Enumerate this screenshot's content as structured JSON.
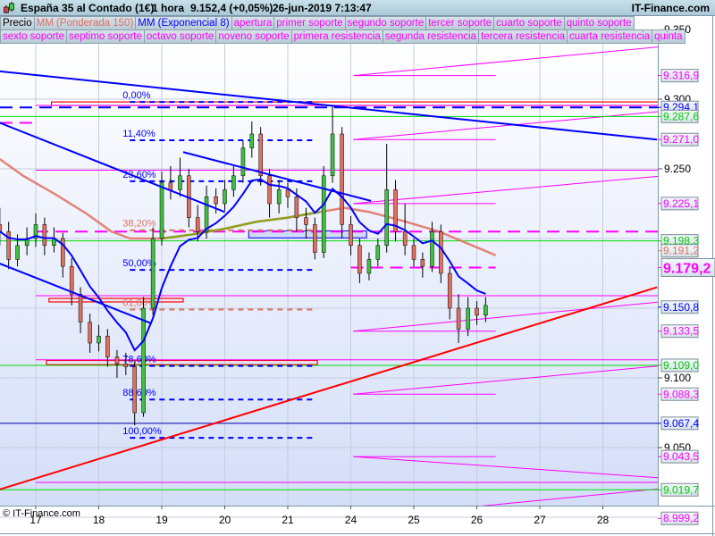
{
  "header": {
    "title": "España 35 al Contado (1€)",
    "interval": "1 hora",
    "price": "9.152,4 (+0,05%)",
    "datetime": "26-jun-2019 7:13:47",
    "brand": "IT-Finance.com",
    "icon": "candlestick-icon"
  },
  "legend": {
    "row1": [
      {
        "label": "Precio",
        "color": "#000000"
      },
      {
        "label": "MM (Ponderada 150)",
        "color": "#e07060"
      },
      {
        "label": "MM (Exponencial 8)",
        "color": "#0000ff"
      },
      {
        "label": "apertura",
        "color": "#ff00ff"
      },
      {
        "label": "primer soporte",
        "color": "#ff00ff"
      },
      {
        "label": "segundo soporte",
        "color": "#ff00ff"
      },
      {
        "label": "tercer soporte",
        "color": "#ff00ff"
      },
      {
        "label": "cuarto soporte",
        "color": "#ff00ff"
      },
      {
        "label": "quinto soporte",
        "color": "#ff00ff"
      }
    ],
    "row2": [
      {
        "label": "sexto soporte",
        "color": "#ff00ff"
      },
      {
        "label": "septimo soporte",
        "color": "#ff00ff"
      },
      {
        "label": "octavo soporte",
        "color": "#ff00ff"
      },
      {
        "label": "noveno soporte",
        "color": "#ff00ff"
      },
      {
        "label": "primera resistencia",
        "color": "#ff00ff"
      },
      {
        "label": "segunda resistencia",
        "color": "#ff00ff"
      },
      {
        "label": "tercera resistencia",
        "color": "#ff00ff"
      },
      {
        "label": "cuarta resistencia",
        "color": "#ff00ff"
      },
      {
        "label": "quinta",
        "color": "#ff00ff"
      }
    ]
  },
  "copyright": "© IT-Finance.com",
  "chart_data": {
    "type": "candlestick",
    "title": "España 35 al Contado (1€)",
    "x_ticks": [
      "17",
      "18",
      "19",
      "20",
      "21",
      "24",
      "25",
      "26",
      "27",
      "28"
    ],
    "y_ticks": [
      "9.350",
      "9.300",
      "9.250",
      "9.100",
      "9.050"
    ],
    "ylim": [
      8.991,
      9.36
    ],
    "grid": true,
    "colors": {
      "up": "#40c040",
      "down": "#e07060",
      "wick": "#000000",
      "ema": "#0000ff",
      "wma": "#e07060",
      "wma_alt": "#90a020",
      "pivot": "#ff00ff",
      "support_green": "#00dd00",
      "trend_red": "#ff0000"
    },
    "candles": [
      [
        16.43,
        9.21,
        9.222,
        9.195,
        9.205
      ],
      [
        16.57,
        9.205,
        9.212,
        9.178,
        9.185
      ],
      [
        16.71,
        9.185,
        9.203,
        9.18,
        9.195
      ],
      [
        16.86,
        9.195,
        9.208,
        9.188,
        9.2
      ],
      [
        17.0,
        9.2,
        9.218,
        9.194,
        9.21
      ],
      [
        17.14,
        9.21,
        9.215,
        9.188,
        9.195
      ],
      [
        17.29,
        9.195,
        9.208,
        9.19,
        9.2
      ],
      [
        17.43,
        9.2,
        9.204,
        9.172,
        9.18
      ],
      [
        17.57,
        9.18,
        9.186,
        9.152,
        9.16
      ],
      [
        17.71,
        9.16,
        9.165,
        9.132,
        9.14
      ],
      [
        17.86,
        9.14,
        9.146,
        9.118,
        9.125
      ],
      [
        18.0,
        9.125,
        9.138,
        9.119,
        9.13
      ],
      [
        18.14,
        9.13,
        9.135,
        9.108,
        9.115
      ],
      [
        18.29,
        9.115,
        9.12,
        9.1,
        9.11
      ],
      [
        18.43,
        9.11,
        9.118,
        9.102,
        9.108
      ],
      [
        18.57,
        9.108,
        9.112,
        9.066,
        9.075
      ],
      [
        18.71,
        9.075,
        9.158,
        9.072,
        9.15
      ],
      [
        18.86,
        9.15,
        9.208,
        9.145,
        9.2
      ],
      [
        19.0,
        9.2,
        9.248,
        9.195,
        9.24
      ],
      [
        19.14,
        9.24,
        9.252,
        9.228,
        9.235
      ],
      [
        19.29,
        9.235,
        9.258,
        9.23,
        9.245
      ],
      [
        19.43,
        9.245,
        9.25,
        9.208,
        9.215
      ],
      [
        19.57,
        9.215,
        9.224,
        9.198,
        9.205
      ],
      [
        19.71,
        9.205,
        9.238,
        9.2,
        9.23
      ],
      [
        19.86,
        9.23,
        9.236,
        9.218,
        9.225
      ],
      [
        20.0,
        9.225,
        9.242,
        9.22,
        9.235
      ],
      [
        20.14,
        9.235,
        9.252,
        9.23,
        9.245
      ],
      [
        20.29,
        9.245,
        9.27,
        9.24,
        9.265
      ],
      [
        20.43,
        9.265,
        9.284,
        9.258,
        9.275
      ],
      [
        20.57,
        9.275,
        9.28,
        9.238,
        9.245
      ],
      [
        20.71,
        9.245,
        9.25,
        9.215,
        9.225
      ],
      [
        20.86,
        9.225,
        9.242,
        9.218,
        9.235
      ],
      [
        21.0,
        9.235,
        9.24,
        9.222,
        9.23
      ],
      [
        21.14,
        9.23,
        9.236,
        9.205,
        9.215
      ],
      [
        21.29,
        9.215,
        9.222,
        9.2,
        9.21
      ],
      [
        21.43,
        9.21,
        9.215,
        9.185,
        9.19
      ],
      [
        21.57,
        9.19,
        9.252,
        9.186,
        9.245
      ],
      [
        21.71,
        9.245,
        9.295,
        9.24,
        9.275
      ],
      [
        21.86,
        9.275,
        9.28,
        9.2,
        9.21
      ],
      [
        24.0,
        9.21,
        9.216,
        9.188,
        9.195
      ],
      [
        24.14,
        9.195,
        9.2,
        9.168,
        9.175
      ],
      [
        24.29,
        9.175,
        9.19,
        9.17,
        9.185
      ],
      [
        24.43,
        9.185,
        9.2,
        9.18,
        9.195
      ],
      [
        24.57,
        9.195,
        9.268,
        9.19,
        9.235
      ],
      [
        24.71,
        9.235,
        9.242,
        9.198,
        9.205
      ],
      [
        24.86,
        9.205,
        9.225,
        9.188,
        9.195
      ],
      [
        25.0,
        9.195,
        9.2,
        9.18,
        9.185
      ],
      [
        25.14,
        9.185,
        9.19,
        9.172,
        9.18
      ],
      [
        25.29,
        9.18,
        9.212,
        9.176,
        9.205
      ],
      [
        25.43,
        9.205,
        9.21,
        9.168,
        9.175
      ],
      [
        25.57,
        9.175,
        9.18,
        9.142,
        9.15
      ],
      [
        25.71,
        9.15,
        9.16,
        9.125,
        9.135
      ],
      [
        25.86,
        9.135,
        9.158,
        9.13,
        9.15
      ],
      [
        26.0,
        9.15,
        9.155,
        9.138,
        9.145
      ],
      [
        26.14,
        9.145,
        9.158,
        9.14,
        9.152
      ]
    ],
    "ema_period": 8,
    "wma_150": [
      [
        16.43,
        9.257
      ],
      [
        16.8,
        9.245
      ],
      [
        17.3,
        9.232
      ],
      [
        17.8,
        9.218
      ],
      [
        18.2,
        9.205
      ],
      [
        18.5,
        9.2
      ],
      [
        19.0,
        9.2
      ],
      [
        19.5,
        9.203
      ],
      [
        20.0,
        9.207
      ],
      [
        20.5,
        9.212
      ],
      [
        21.0,
        9.215
      ],
      [
        21.5,
        9.219
      ],
      [
        21.9,
        9.222
      ],
      [
        24.3,
        9.219
      ],
      [
        24.8,
        9.213
      ],
      [
        25.4,
        9.205
      ],
      [
        26.3,
        9.188
      ]
    ],
    "wma_150_alt_segment": [
      18.6,
      21.8
    ],
    "trend_lines": [
      {
        "color": "#0000ff",
        "from": [
          16.43,
          9.32
        ],
        "to": [
          28.86,
          9.271
        ]
      },
      {
        "color": "#0000ff",
        "from": [
          16.43,
          9.283
        ],
        "to": [
          20.0,
          9.219
        ]
      },
      {
        "color": "#0000ff",
        "from": [
          19.34,
          9.262
        ],
        "to": [
          24.32,
          9.227
        ]
      },
      {
        "color": "#0000ff",
        "from": [
          16.43,
          9.182
        ],
        "to": [
          18.84,
          9.139
        ]
      },
      {
        "color": "#ff0000",
        "from": [
          16.43,
          9.02
        ],
        "to": [
          28.86,
          9.165
        ]
      }
    ],
    "horizontal_lines": [
      {
        "price": 9.2941,
        "color": "#0000ff",
        "style": "long-dash"
      },
      {
        "price": 9.2876,
        "color": "#00dd00",
        "style": "solid"
      },
      {
        "price": 9.1983,
        "color": "#00dd00",
        "style": "solid"
      },
      {
        "price": 9.109,
        "color": "#00dd00",
        "style": "solid"
      },
      {
        "price": 9.0197,
        "color": "#00dd00",
        "style": "solid"
      },
      {
        "price": 9.0674,
        "color": "#0000aa",
        "style": "solid"
      }
    ],
    "apertura": [
      {
        "price": 9.283,
        "from": 16.43,
        "to": 17.0
      },
      {
        "price": 9.205,
        "from": 17.0,
        "to": 23.96
      },
      {
        "price": 9.1792,
        "from": 24.0,
        "to": 26.3
      }
    ],
    "pivot_levels": {
      "previous": {
        "from": 17.0,
        "to": 23.96,
        "levels": [
          9.342,
          9.2955,
          9.249,
          9.159,
          9.113,
          9.025
        ]
      },
      "current": {
        "from": 24.04,
        "to": 26.3,
        "levels": [
          9.3169,
          9.271,
          9.2251,
          9.1335,
          9.0883,
          9.0435,
          8.9992
        ]
      }
    },
    "zones": [
      {
        "from": 17.17,
        "to": 21.47,
        "low": 9.1095,
        "high": 9.1125,
        "color": "#ff0000"
      },
      {
        "from": 17.21,
        "to": 19.34,
        "low": 9.1545,
        "high": 9.157,
        "color": "#ff0000"
      },
      {
        "from": 17.25,
        "to": 23.96,
        "low": 9.2955,
        "high": 9.298,
        "color": "#ff0000"
      },
      {
        "from": 20.38,
        "to": 24.25,
        "low": 9.2005,
        "high": 9.2055,
        "color": "#0000ff"
      }
    ],
    "fibonacci": {
      "from": 18.38,
      "to": 21.43,
      "high": 9.298,
      "low": 9.057,
      "levels": [
        {
          "ratio": 0.0,
          "label": "0,00%",
          "color": "#0000ff"
        },
        {
          "ratio": 0.114,
          "label": "11,40%",
          "color": "#0000ff"
        },
        {
          "ratio": 0.236,
          "label": "23,60%",
          "color": "#0000ff"
        },
        {
          "ratio": 0.382,
          "label": "38,20%",
          "color": "#e07060"
        },
        {
          "ratio": 0.5,
          "label": "50,00%",
          "color": "#0000ff"
        },
        {
          "ratio": 0.618,
          "label": "61,80%",
          "color": "#e07060"
        },
        {
          "ratio": 0.786,
          "label": "78,60%",
          "color": "#0000ff"
        },
        {
          "ratio": 0.886,
          "label": "88,60%",
          "color": "#0000ff"
        },
        {
          "ratio": 1.0,
          "label": "100,00%",
          "color": "#0000ff"
        }
      ]
    },
    "value_labels": [
      {
        "text": "9.316,9",
        "color": "#ff00ff"
      },
      {
        "text": "9.294,1",
        "color": "#0000ff"
      },
      {
        "text": "9.287,6",
        "color": "#00cc00"
      },
      {
        "text": "9.271,0",
        "color": "#ff00ff"
      },
      {
        "text": "9.225,1",
        "color": "#ff00ff"
      },
      {
        "text": "9.198,3",
        "color": "#00cc00"
      },
      {
        "text": "9.191,2",
        "color": "#e07060"
      },
      {
        "text": "9.179,2",
        "color": "#ff00ff",
        "emphasis": true
      },
      {
        "text": "9.150,8",
        "color": "#0000ff"
      },
      {
        "text": "9.133,5",
        "color": "#ff00ff"
      },
      {
        "text": "9.109,0",
        "color": "#00cc00"
      },
      {
        "text": "9.088,3",
        "color": "#ff00ff"
      },
      {
        "text": "9.067,4",
        "color": "#0000ff"
      },
      {
        "text": "9.043,5",
        "color": "#ff00ff"
      },
      {
        "text": "9.019,7",
        "color": "#00cc00"
      },
      {
        "text": "8.999,2",
        "color": "#ff00ff"
      }
    ]
  }
}
